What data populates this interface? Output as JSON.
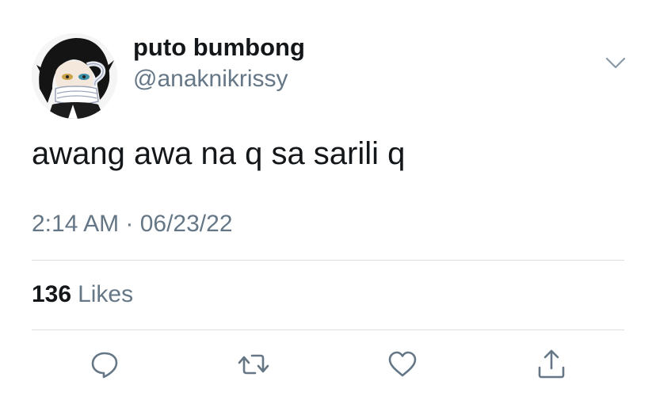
{
  "tweet": {
    "display_name": "puto bumbong",
    "handle": "@anaknikrissy",
    "text": "awang awa na q sa sarili q",
    "timestamp": "2:14 AM · 06/23/22",
    "likes_count": "136",
    "likes_label": "Likes"
  },
  "actions": [
    {
      "name": "reply",
      "icon": "speech-bubble-icon"
    },
    {
      "name": "retweet",
      "icon": "retweet-arrows-icon"
    },
    {
      "name": "like",
      "icon": "heart-icon"
    },
    {
      "name": "share",
      "icon": "share-upload-icon"
    }
  ],
  "colors": {
    "text": "#14171a",
    "secondary": "#657786",
    "icon": "#657786",
    "divider": "#dcdfe2"
  }
}
